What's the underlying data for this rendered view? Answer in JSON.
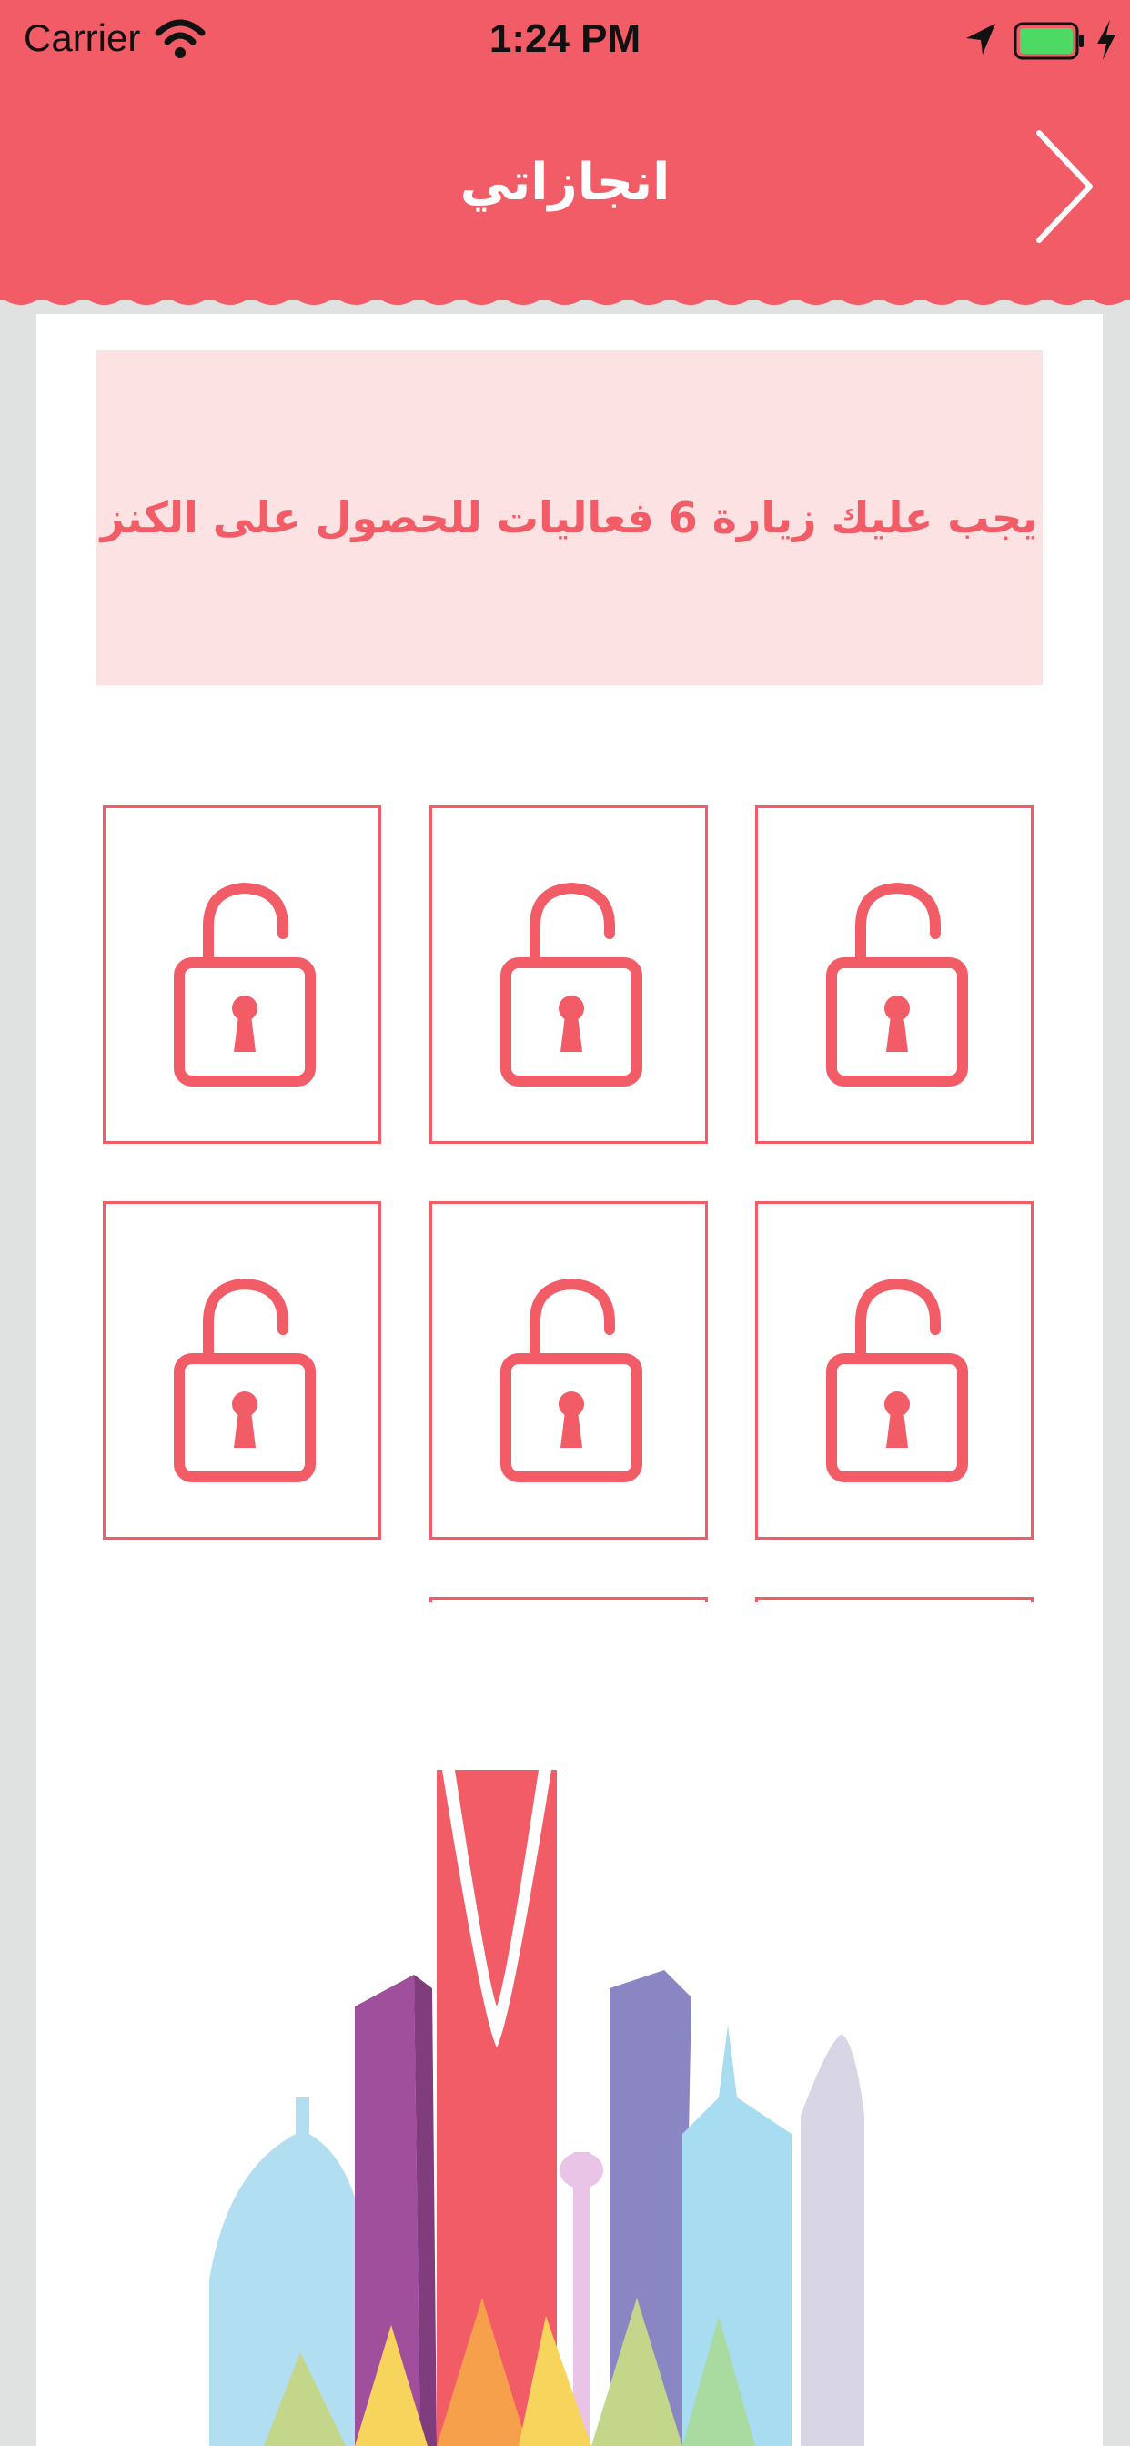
{
  "status_bar": {
    "carrier": "Carrier",
    "time": "1:24 PM",
    "icons": [
      "wifi-icon",
      "location-arrow-icon",
      "battery-icon",
      "charging-bolt-icon"
    ]
  },
  "nav": {
    "title": "انجازاتي",
    "back_icon": "chevron-icon"
  },
  "banner": {
    "message": "يجب عليك زيارة 6 فعاليات للحصول على الكنز"
  },
  "achievements": {
    "icon": "unlocked-padlock-icon",
    "tiles_full": 6,
    "tiles_partial": 2
  },
  "illustration": {
    "name": "riyadh-skyline-illustration"
  },
  "colors": {
    "accent": "#f25c66",
    "banner_bg": "#fde2e4",
    "page_bg": "#dfe2e1"
  }
}
